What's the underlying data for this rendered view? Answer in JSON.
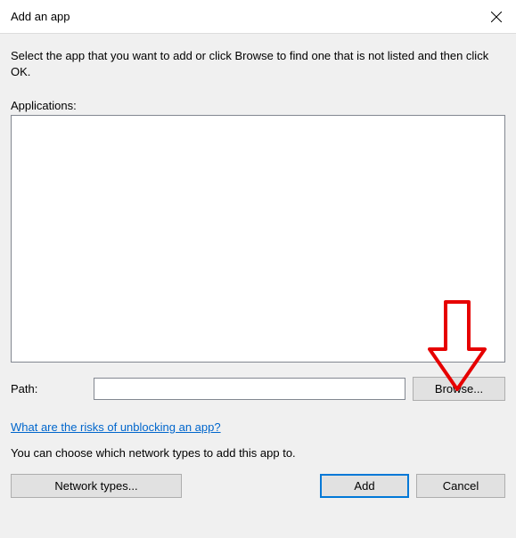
{
  "titlebar": {
    "title": "Add an app"
  },
  "content": {
    "instructions": "Select the app that you want to add or click Browse to find one that is not listed and then click OK.",
    "applications_label": "Applications:",
    "path_label": "Path:",
    "path_value": "",
    "browse_button": "Browse...",
    "risks_link": "What are the risks of unblocking an app?",
    "network_text": "You can choose which network types to add this app to.",
    "network_types_button": "Network types...",
    "add_button": "Add",
    "cancel_button": "Cancel"
  }
}
